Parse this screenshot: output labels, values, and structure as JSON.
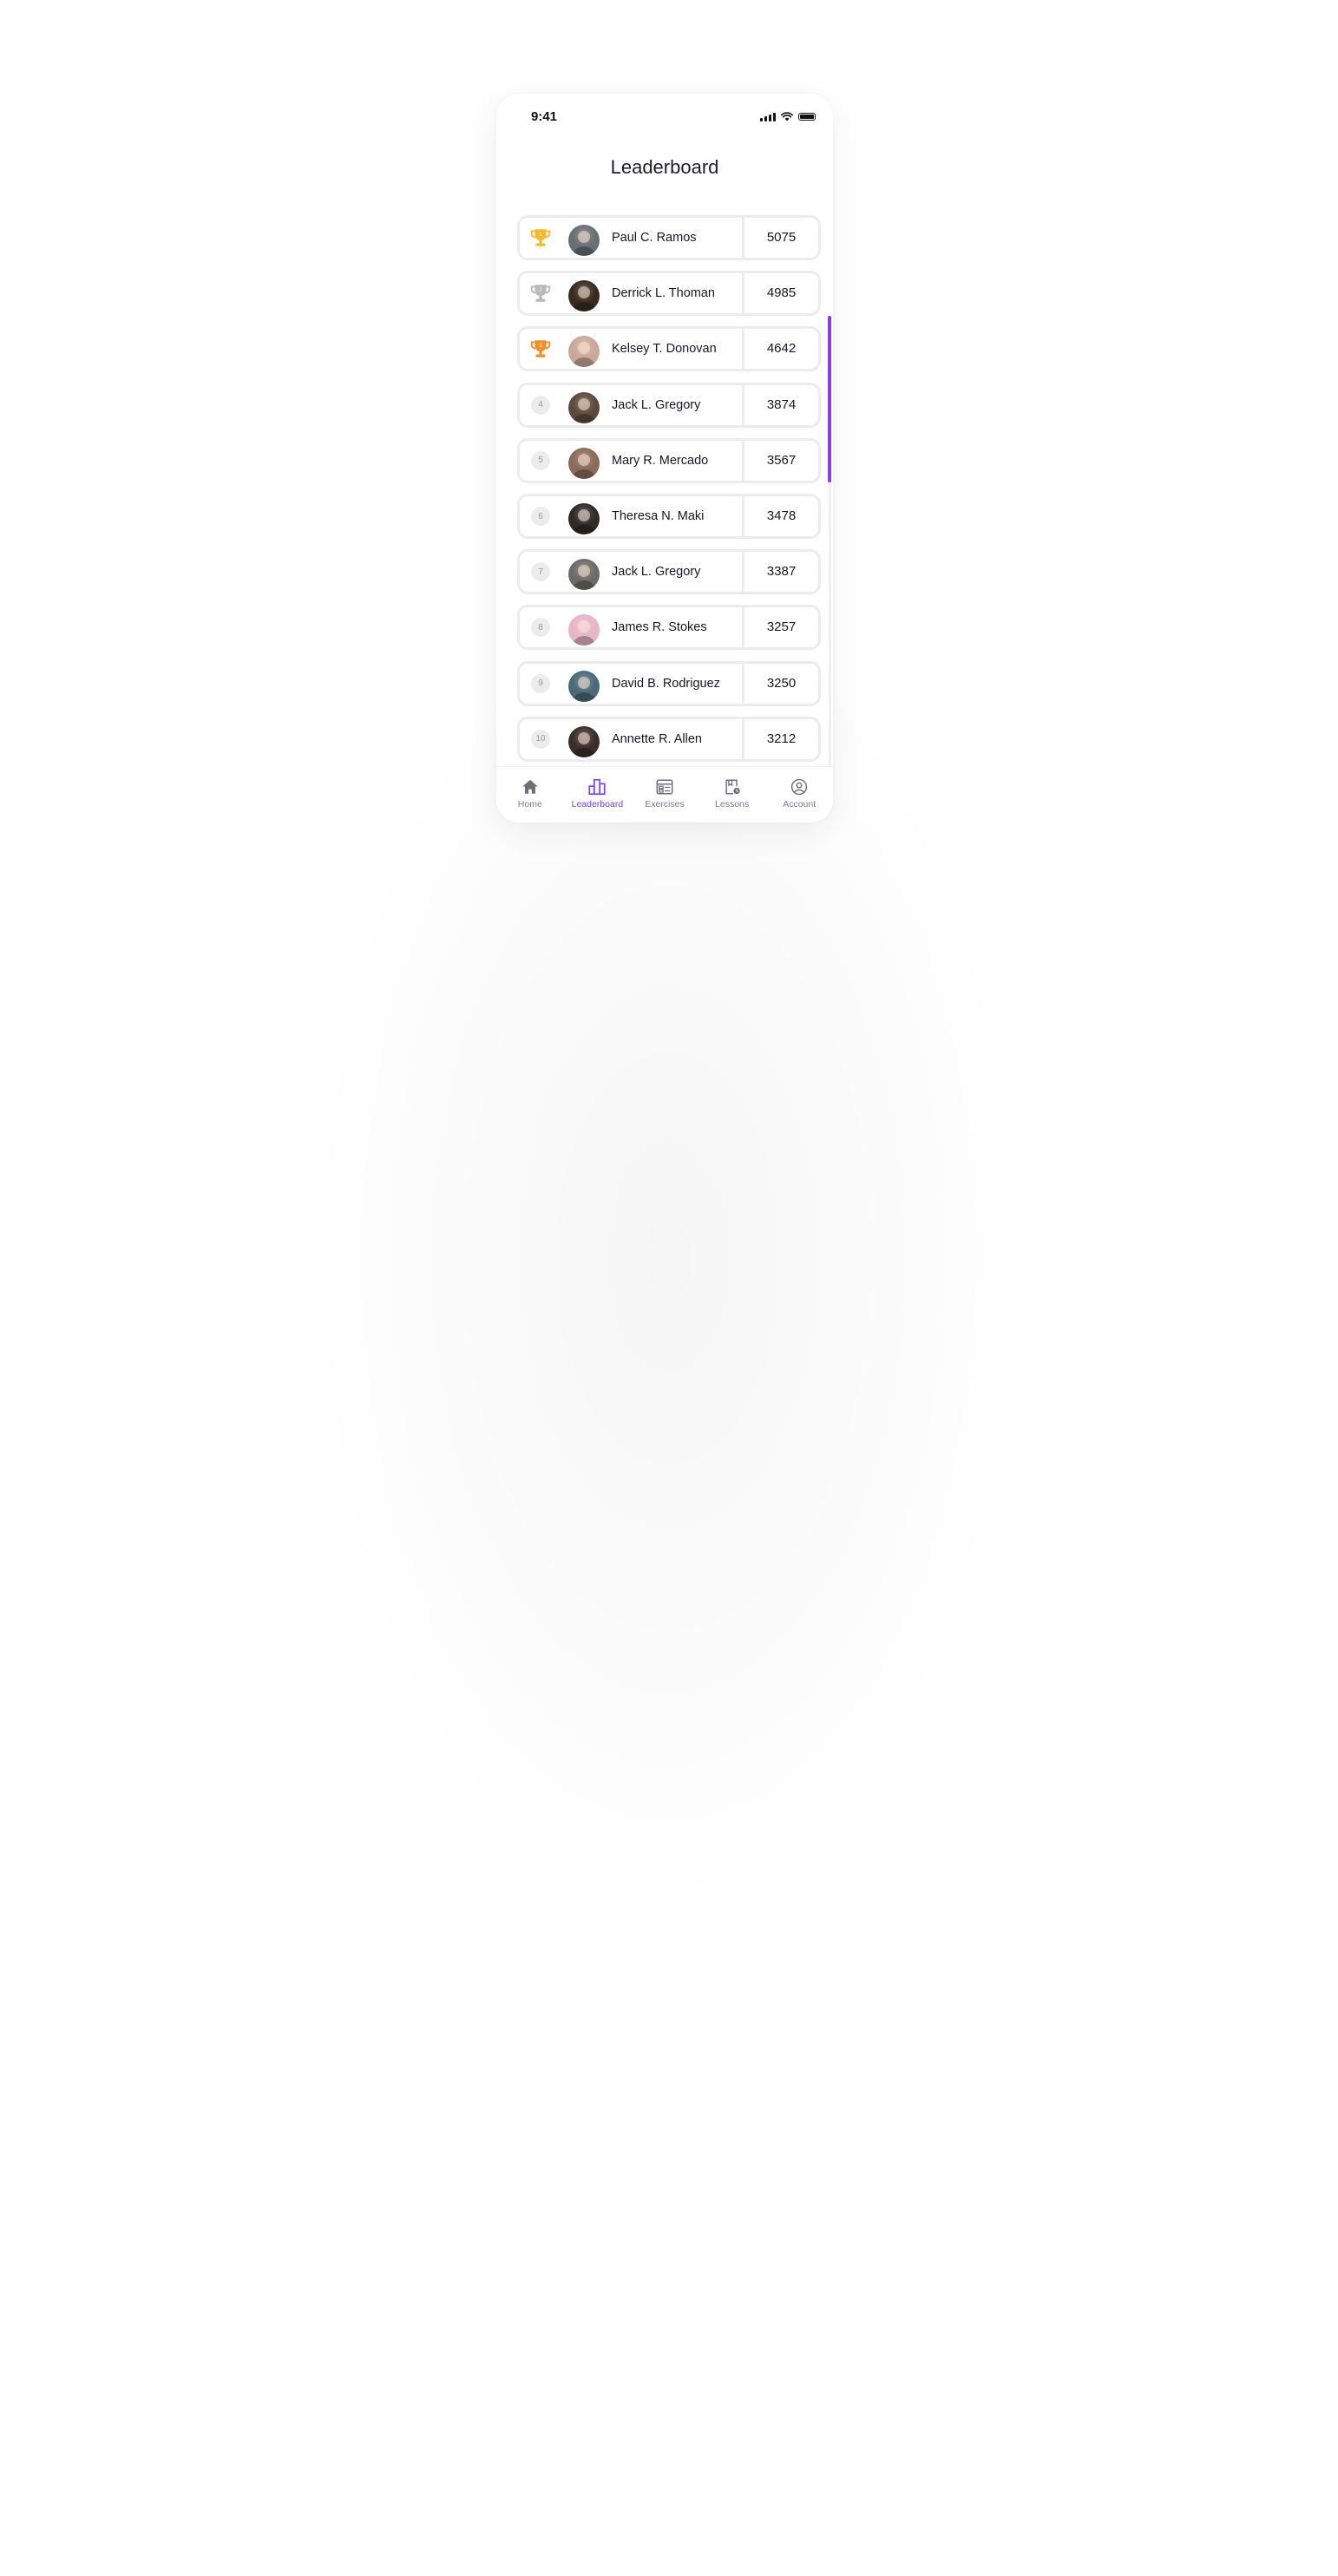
{
  "status_bar": {
    "time": "9:41"
  },
  "page": {
    "title": "Leaderboard"
  },
  "leaderboard": [
    {
      "rank": "1",
      "badge": "gold-trophy",
      "name": "Paul C. Ramos",
      "score": "5075",
      "avatar_color": "#6a6d73"
    },
    {
      "rank": "2",
      "badge": "silver-trophy",
      "name": "Derrick L. Thoman",
      "score": "4985",
      "avatar_color": "#3a2a22"
    },
    {
      "rank": "3",
      "badge": "bronze-trophy",
      "name": "Kelsey T. Donovan",
      "score": "4642",
      "avatar_color": "#caa89a"
    },
    {
      "rank": "4",
      "badge": "number",
      "name": "Jack L. Gregory",
      "score": "3874",
      "avatar_color": "#5e4a3c"
    },
    {
      "rank": "5",
      "badge": "number",
      "name": "Mary R. Mercado",
      "score": "3567",
      "avatar_color": "#8a6a5a"
    },
    {
      "rank": "6",
      "badge": "number",
      "name": "Theresa N. Maki",
      "score": "3478",
      "avatar_color": "#2f2a2a"
    },
    {
      "rank": "7",
      "badge": "number",
      "name": "Jack L. Gregory",
      "score": "3387",
      "avatar_color": "#6d6b66"
    },
    {
      "rank": "8",
      "badge": "number",
      "name": "James R. Stokes",
      "score": "3257",
      "avatar_color": "#e6b5c6"
    },
    {
      "rank": "9",
      "badge": "number",
      "name": "David B. Rodriguez",
      "score": "3250",
      "avatar_color": "#4a6a7a"
    },
    {
      "rank": "10",
      "badge": "number",
      "name": "Annette R. Allen",
      "score": "3212",
      "avatar_color": "#3b2e2a"
    }
  ],
  "nav": {
    "items": [
      {
        "label": "Home",
        "icon": "home-icon",
        "active": false
      },
      {
        "label": "Leaderboard",
        "icon": "leaderboard-icon",
        "active": true
      },
      {
        "label": "Exercises",
        "icon": "exercises-icon",
        "active": false
      },
      {
        "label": "Lessons",
        "icon": "lessons-icon",
        "active": false
      },
      {
        "label": "Account",
        "icon": "account-icon",
        "active": false
      }
    ]
  },
  "colors": {
    "accent": "#7a3ff0",
    "scroll_thumb": "#8b3cf0",
    "gold": "#f3b92e",
    "silver": "#b9b9b9",
    "bronze": "#f28f2c"
  }
}
